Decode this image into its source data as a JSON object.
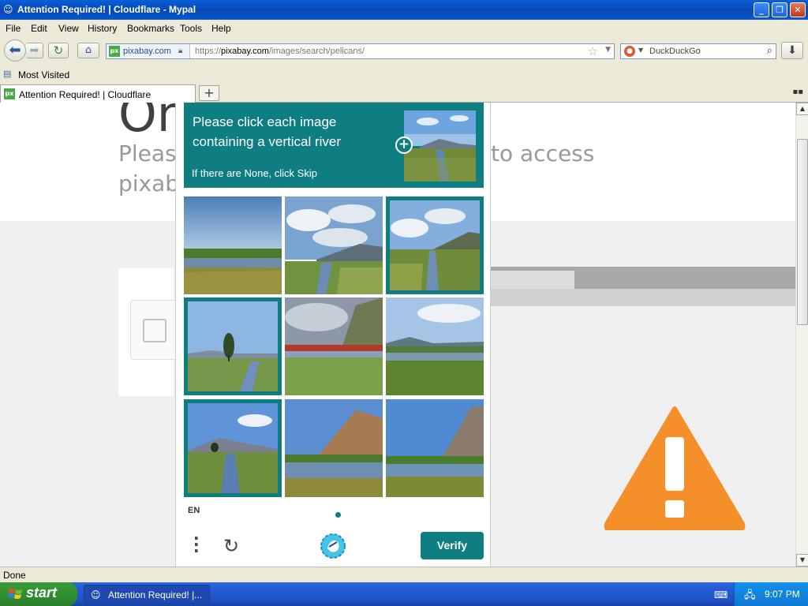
{
  "window": {
    "title": "Attention Required! | Cloudflare - Mypal",
    "icon": "mypal-icon",
    "minimize": "_",
    "restore": "❐",
    "close": "✕"
  },
  "menu": [
    "File",
    "Edit",
    "View",
    "History",
    "Bookmarks",
    "Tools",
    "Help"
  ],
  "nav": {
    "site_badge": "px",
    "site_name": "pixabay.com",
    "url_prefix": "https://",
    "url_host": "pixabay.com",
    "url_path": "/images/search/pelicans/",
    "search_engine": "DuckDuckGo"
  },
  "bookmarks": {
    "label": "Most Visited"
  },
  "tab": {
    "label": "Attention Required! | Cloudflare",
    "new_tab": "+"
  },
  "page": {
    "heading": "On",
    "sub_line1": "Please",
    "sub_right": "to access",
    "sub_line2": "pixab"
  },
  "captcha": {
    "prompt": "Please click each image containing a vertical river",
    "skip_hint": "If there are None, click Skip",
    "language": "EN",
    "verify": "Verify",
    "selected_tiles": [
      3,
      4,
      7
    ],
    "accent_color": "#0f7e83"
  },
  "status": {
    "text": "Done"
  },
  "taskbar": {
    "start": "start",
    "task_label": "Attention Required! |...",
    "clock": "9:07 PM"
  }
}
